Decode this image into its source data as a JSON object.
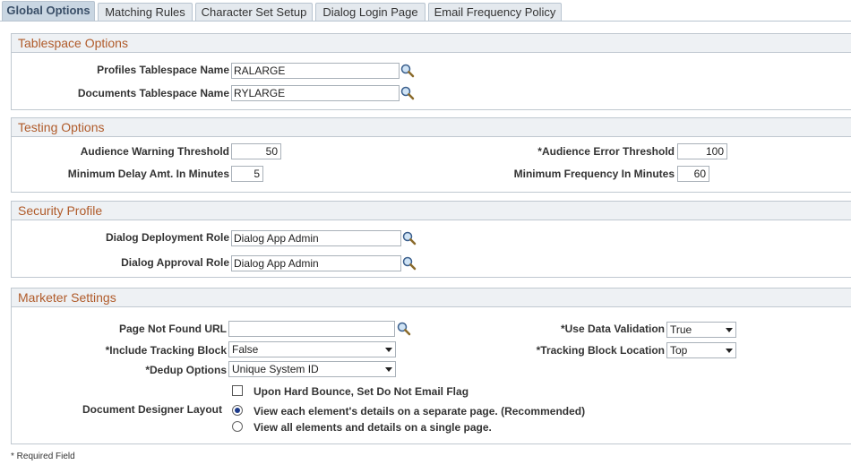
{
  "tabs": [
    {
      "label": "Global Options"
    },
    {
      "label": "Matching Rules"
    },
    {
      "label": "Character Set Setup"
    },
    {
      "label": "Dialog Login Page"
    },
    {
      "label": "Email Frequency Policy"
    }
  ],
  "tablespace": {
    "title": "Tablespace Options",
    "profiles_label": "Profiles Tablespace Name",
    "profiles_value": "RALARGE",
    "documents_label": "Documents Tablespace Name",
    "documents_value": "RYLARGE"
  },
  "testing": {
    "title": "Testing Options",
    "warning_label": "Audience Warning Threshold",
    "warning_value": "50",
    "error_label": "*Audience Error Threshold",
    "error_value": "100",
    "delay_label": "Minimum Delay Amt. In Minutes",
    "delay_value": "5",
    "frequency_label": "Minimum Frequency In Minutes",
    "frequency_value": "60"
  },
  "security": {
    "title": "Security Profile",
    "deployment_label": "Dialog Deployment Role",
    "deployment_value": "Dialog App Admin",
    "approval_label": "Dialog Approval Role",
    "approval_value": "Dialog App Admin"
  },
  "marketer": {
    "title": "Marketer Settings",
    "page_not_found_label": "Page Not Found URL",
    "page_not_found_value": "",
    "use_validation_label": "*Use Data Validation",
    "use_validation_value": "True",
    "include_tracking_label": "*Include Tracking Block",
    "include_tracking_value": "False",
    "tracking_location_label": "*Tracking Block Location",
    "tracking_location_value": "Top",
    "dedup_label": "*Dedup Options",
    "dedup_value": "Unique System ID",
    "hard_bounce_label": "Upon Hard Bounce, Set Do Not Email Flag",
    "hard_bounce_checked": false,
    "designer_label": "Document Designer Layout",
    "layout_option_1": "View each element's details on a separate page. (Recommended)",
    "layout_option_2": "View all elements and details on a single page.",
    "layout_selected": 1
  },
  "footer": {
    "required_note": "* Required Field"
  },
  "icons": {
    "lookup": "magnifier-icon"
  }
}
